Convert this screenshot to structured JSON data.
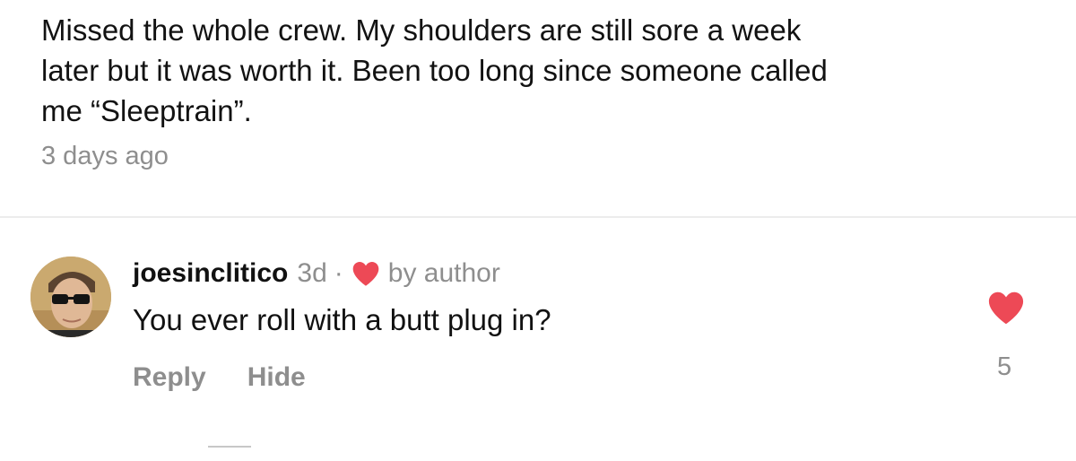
{
  "caption": {
    "lines": [
      "Missed the whole crew. My shoulders are still sore a week",
      "later but it was worth it. Been too long since someone called",
      "me “Sleeptrain”."
    ],
    "timestamp": "3 days ago"
  },
  "comment": {
    "username": "joesinclitico",
    "age": "3d",
    "separator": "·",
    "author_badge": "by author",
    "text": "You ever roll with a butt plug in?",
    "reply_label": "Reply",
    "hide_label": "Hide",
    "like_count": "5"
  },
  "colors": {
    "heart": "#ed4956",
    "muted": "#8e8e8e",
    "text": "#111111",
    "divider": "#ececec"
  },
  "icons": {
    "author_like": "heart-icon",
    "like_button": "heart-icon"
  }
}
